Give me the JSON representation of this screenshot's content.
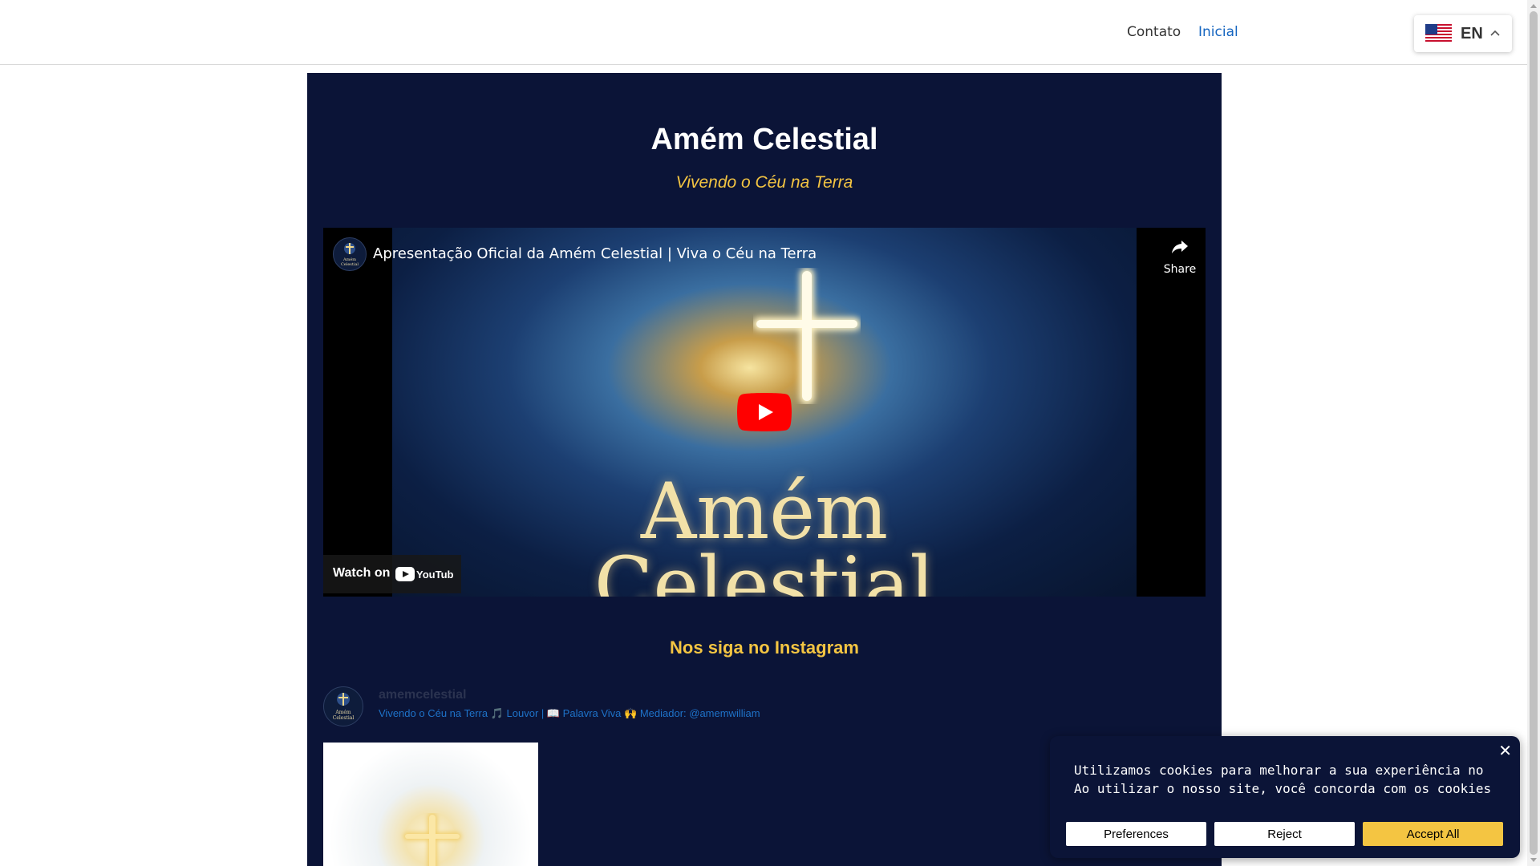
{
  "nav": {
    "contact": "Contato",
    "home": "Inicial",
    "language": {
      "code": "EN",
      "flag": "us-flag-icon"
    }
  },
  "hero": {
    "title": "Amém Celestial",
    "subtitle": "Vivendo o Céu na Terra"
  },
  "video": {
    "title": "Apresentação Oficial da Amém Celestial | Viva o Céu na Terra",
    "share_label": "Share",
    "watch_on": "Watch on",
    "youtube_label": "YouTube",
    "brand_line1": "Amém",
    "brand_line2": "Celestial",
    "avatar_line1": "Amém",
    "avatar_line2": "Celestial"
  },
  "instagram": {
    "heading": "Nos siga no Instagram",
    "username": "amemcelestial",
    "bio": "Vivendo o Céu na Terra 🎵 Louvor | 📖 Palavra Viva 🙌 Mediador: @amemwilliam",
    "avatar_line1": "Amém",
    "avatar_line2": "Celestial"
  },
  "cookie": {
    "line1": "Utilizamos cookies para melhorar a sua experiência no no",
    "line2": "Ao utilizar o nosso site, você concorda com os cookies.",
    "close": "✕",
    "preferences": "Preferences",
    "reject": "Reject",
    "accept_all": "Accept All"
  },
  "colors": {
    "panel_bg": "#0b1437",
    "accent_gold": "#f4c542",
    "link_blue": "#1565c0"
  }
}
